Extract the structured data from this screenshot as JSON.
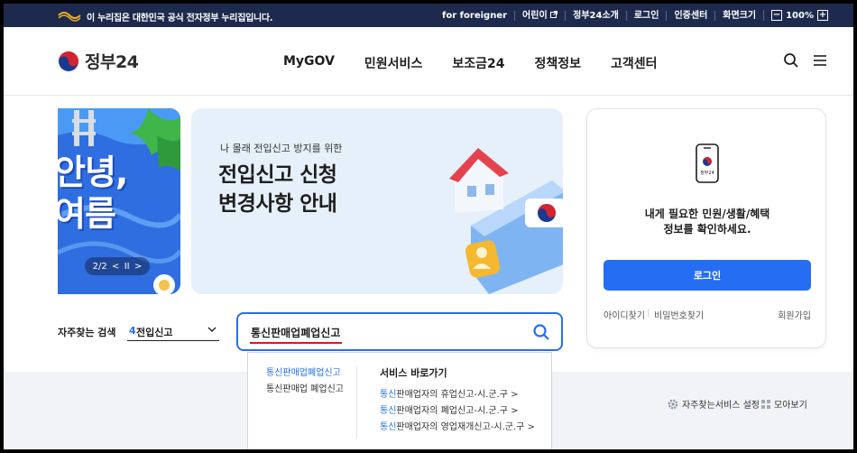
{
  "topbar": {
    "notice": "이 누리집은 대한민국 공식 전자정부 누리집입니다.",
    "links": [
      "for foreigner",
      "어린이",
      "정부24소개",
      "로그인",
      "인증센터",
      "화면크기"
    ],
    "zoom": {
      "minus": "−",
      "value": "100%",
      "plus": "+"
    }
  },
  "header": {
    "logo_text": "정부24",
    "nav": [
      "MyGOV",
      "민원서비스",
      "보조금24",
      "정책정보",
      "고객센터"
    ]
  },
  "banner_left": {
    "headline_line1": "안녕,",
    "headline_line2": "여름",
    "pager": {
      "current": "2/2",
      "prev": "<",
      "pause": "II",
      "next": ">"
    }
  },
  "banner_main": {
    "kicker": "나 몰래 전입신고 방지를 위한",
    "title_line1": "전입신고 신청",
    "title_line2": "변경사항 안내"
  },
  "login_card": {
    "phone_label": "정부24",
    "message_line1": "내게 필요한 민원/생활/혜택",
    "message_line2": "정보를 확인하세요.",
    "login_button": "로그인",
    "find_id": "아이디찾기",
    "find_password": "비밀번호찾기",
    "signup": "회원가입"
  },
  "search": {
    "frequent_label": "자주찾는 검색",
    "frequent_rank": "4",
    "frequent_value": "전입신고",
    "query": "통신판매업폐업신고"
  },
  "autocomplete": {
    "suggestions": [
      {
        "text": "통신판매업폐업신고",
        "active": true
      },
      {
        "text": "통신판매업 폐업신고",
        "active": false
      }
    ],
    "shortcut_header": "서비스 바로가기",
    "shortcuts": [
      {
        "highlight": "통신",
        "rest": "판매업자의 휴업신고-시.군.구",
        "arrow": ">"
      },
      {
        "highlight": "통신",
        "rest": "판매업자의 폐업신고-시.군.구",
        "arrow": ">"
      },
      {
        "highlight": "통신",
        "rest": "판매업자의 영업재개신고-시.군.구",
        "arrow": ">"
      }
    ]
  },
  "lower": {
    "settings_label": "자주찾는서비스 설정",
    "collect_label": "모아보기"
  },
  "colors": {
    "primary": "#256ef4",
    "topbar": "#1d2a4d",
    "underline": "#e8111c",
    "lower_bg": "#f1f3f6"
  }
}
